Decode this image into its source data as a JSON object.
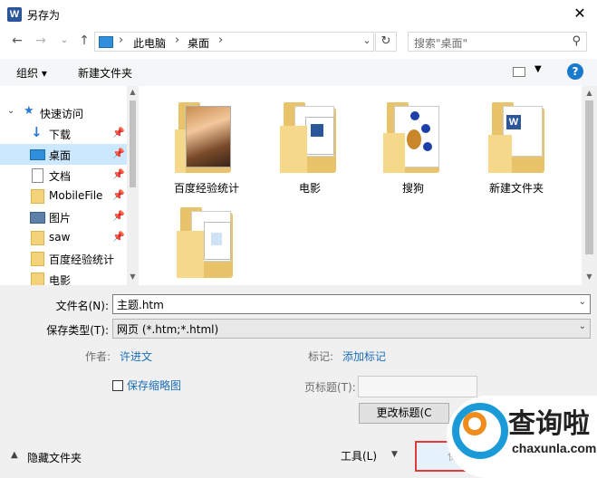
{
  "window": {
    "title": "另存为",
    "app_icon": "W"
  },
  "address": {
    "crumbs": [
      "此电脑",
      "桌面"
    ]
  },
  "search": {
    "placeholder": "搜索\"桌面\""
  },
  "toolbar": {
    "organize": "组织 ▾",
    "new_folder": "新建文件夹"
  },
  "nav": {
    "quick_access": "快速访问",
    "items": [
      {
        "label": "下载",
        "icon": "download-icon"
      },
      {
        "label": "桌面",
        "icon": "desktop-icon",
        "selected": true
      },
      {
        "label": "文档",
        "icon": "document-icon"
      },
      {
        "label": "MobileFile",
        "icon": "folder-icon"
      },
      {
        "label": "图片",
        "icon": "pictures-icon"
      },
      {
        "label": "saw",
        "icon": "folder-icon"
      },
      {
        "label": "百度经验统计",
        "icon": "folder-icon"
      },
      {
        "label": "电影",
        "icon": "folder-icon"
      }
    ]
  },
  "files": [
    {
      "label": "百度经验统计",
      "preview": "photo"
    },
    {
      "label": "电影",
      "preview": "word-docs"
    },
    {
      "label": "搜狗",
      "preview": "logo"
    },
    {
      "label": "新建文件夹",
      "preview": "word-doc"
    },
    {
      "label": "",
      "preview": "docs"
    }
  ],
  "form": {
    "filename_label": "文件名(N):",
    "filename_value": "主题.htm",
    "filetype_label": "保存类型(T):",
    "filetype_value": "网页 (*.htm;*.html)",
    "author_label": "作者:",
    "author_value": "许进文",
    "tags_label": "标记:",
    "tags_value": "添加标记",
    "save_thumbnail": "保存缩略图",
    "page_title_label": "页标题(T):",
    "change_title_button": "更改标题(C",
    "hide_folders": "隐藏文件夹",
    "tools": "工具(L)",
    "save_partial": "保"
  },
  "watermark": {
    "cn": "查询啦",
    "en": "chaxunla.com"
  },
  "colors": {
    "accent": "#1979ca",
    "selection": "#cce8ff",
    "folder": "#e8c36a",
    "highlight_border": "#e23b3b"
  }
}
